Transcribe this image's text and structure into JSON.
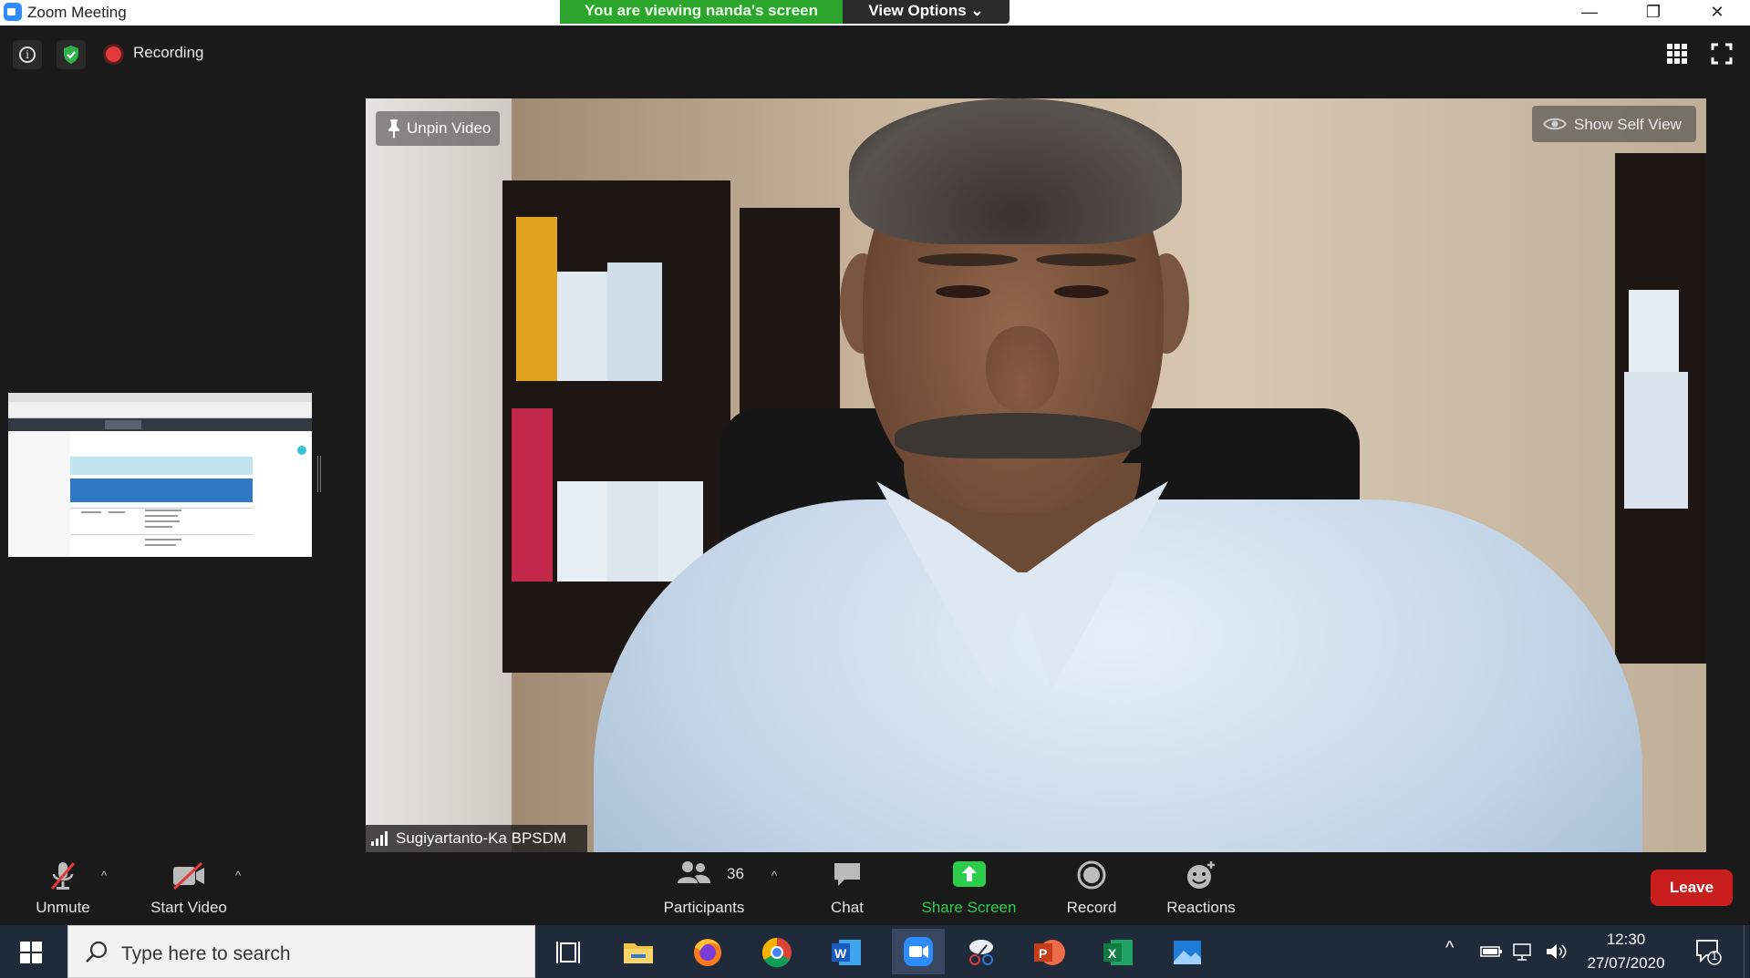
{
  "window": {
    "title": "Zoom Meeting",
    "viewing_banner": "You are viewing nanda's screen",
    "view_options": "View Options ⌄",
    "controls": {
      "minimize": "—",
      "restore": "❐",
      "close": "✕"
    }
  },
  "topbar": {
    "recording_label": "Recording"
  },
  "video": {
    "unpin_label": "Unpin Video",
    "show_self_view_label": "Show Self View",
    "speaker_name": "Sugiyartanto-Ka BPSDM"
  },
  "toolbar": {
    "unmute": "Unmute",
    "start_video": "Start Video",
    "participants": "Participants",
    "participants_count": "36",
    "chat": "Chat",
    "share_screen": "Share Screen",
    "record": "Record",
    "reactions": "Reactions",
    "leave": "Leave",
    "caret": "^"
  },
  "taskbar": {
    "search_placeholder": "Type here to search",
    "time": "12:30",
    "date": "27/07/2020",
    "notifications_count": "1"
  },
  "colors": {
    "viewing_banner": "#2ca52c",
    "share_screen": "#2ccd4b",
    "leave": "#c81e1e",
    "recording_dot": "#e23b3b",
    "zoom_blue": "#2d8cff"
  }
}
